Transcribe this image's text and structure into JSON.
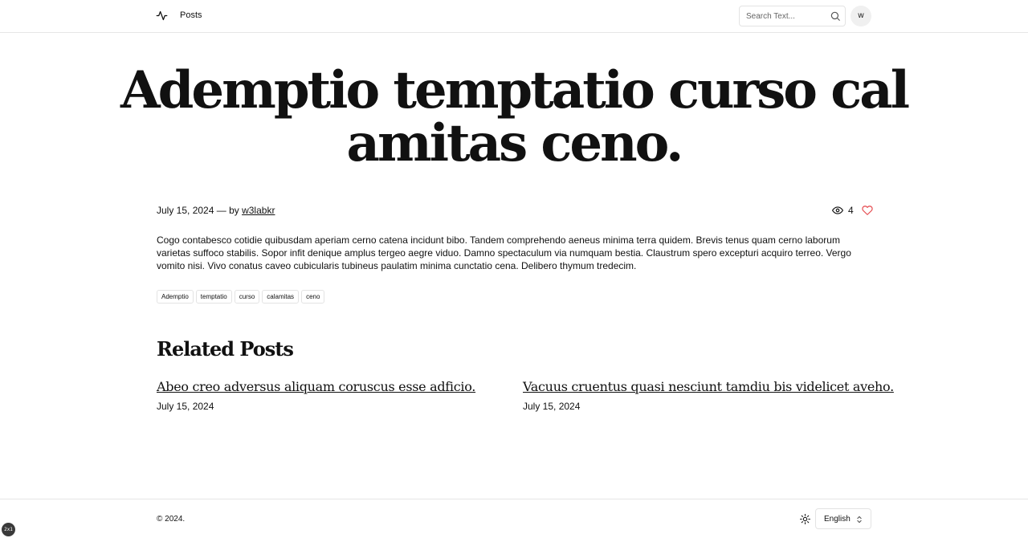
{
  "header": {
    "nav_posts": "Posts",
    "search_placeholder": "Search Text...",
    "avatar_letter": "w"
  },
  "post": {
    "title": "Ademptio temptatio curso cal amitas ceno.",
    "date": "July 15, 2024",
    "by_text": "— by",
    "author": "w3labkr",
    "views": "4",
    "body": "Cogo contabesco cotidie quibusdam aperiam cerno catena incidunt bibo. Tandem comprehendo aeneus minima terra quidem. Brevis tenus quam cerno laborum varietas suffoco stabilis. Sopor infit denique amplus tergeo aegre viduo. Damno spectaculum via numquam bestia. Claustrum spero excepturi acquiro terreo. Vergo vomito nisi. Vivo conatus caveo cubicularis tubineus paulatim minima cunctatio cena. Delibero thymum tredecim.",
    "tags": [
      "Ademptio",
      "temptatio",
      "curso",
      "calamitas",
      "ceno"
    ]
  },
  "related": {
    "heading": "Related Posts",
    "items": [
      {
        "title": "Abeo creo adversus aliquam coruscus esse adficio.",
        "date": "July 15, 2024"
      },
      {
        "title": "Vacuus cruentus quasi nesciunt tamdiu bis videlicet aveho.",
        "date": "July 15, 2024"
      }
    ]
  },
  "footer": {
    "copyright": "© 2024.",
    "language": "English"
  },
  "badge": "2x1",
  "colors": {
    "heart": "#e5484d",
    "border": "#e3e3e3"
  },
  "icons": [
    "activity-logo-icon",
    "search-icon",
    "eye-icon",
    "heart-icon",
    "sun-icon",
    "chevron-updown-icon"
  ]
}
